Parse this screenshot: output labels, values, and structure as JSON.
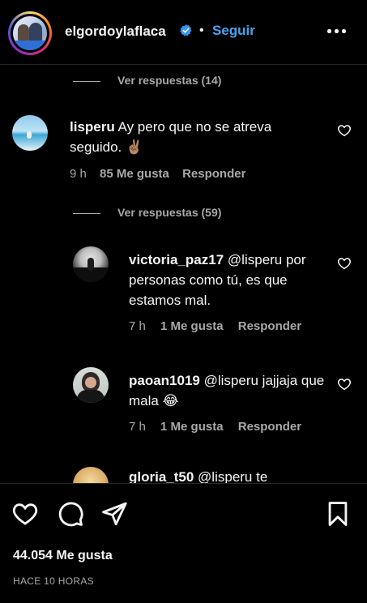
{
  "header": {
    "username": "elgordoylaflaca",
    "separator": "•",
    "follow_label": "Seguir",
    "verified_icon": "verified-badge-icon",
    "more_icon": "more-options-icon"
  },
  "comments": [
    {
      "view_replies_above": "Ver respuestas (14)"
    },
    {
      "user": "lisperu",
      "text": "Ay pero que no se atreva seguido. ✌🏽",
      "time": "9 h",
      "likes": "85 Me gusta",
      "reply": "Responder",
      "view_replies": "Ver respuestas (59)"
    },
    {
      "user": "victoria_paz17",
      "text": "@lisperu por personas como tú, es que estamos mal.",
      "time": "7 h",
      "likes": "1 Me gusta",
      "reply": "Responder"
    },
    {
      "user": "paoan1019",
      "text": "@lisperu jajjaja que mala 😂",
      "time": "7 h",
      "likes": "1 Me gusta",
      "reply": "Responder"
    },
    {
      "user": "gloria_t50",
      "text": "@lisperu te"
    }
  ],
  "footer": {
    "likes": "44.054 Me gusta",
    "time_ago": "HACE 10 HORAS"
  },
  "colors": {
    "background": "#000000",
    "text": "#f5f5f5",
    "muted": "#a8a8a8",
    "link": "#4aa3f0"
  }
}
